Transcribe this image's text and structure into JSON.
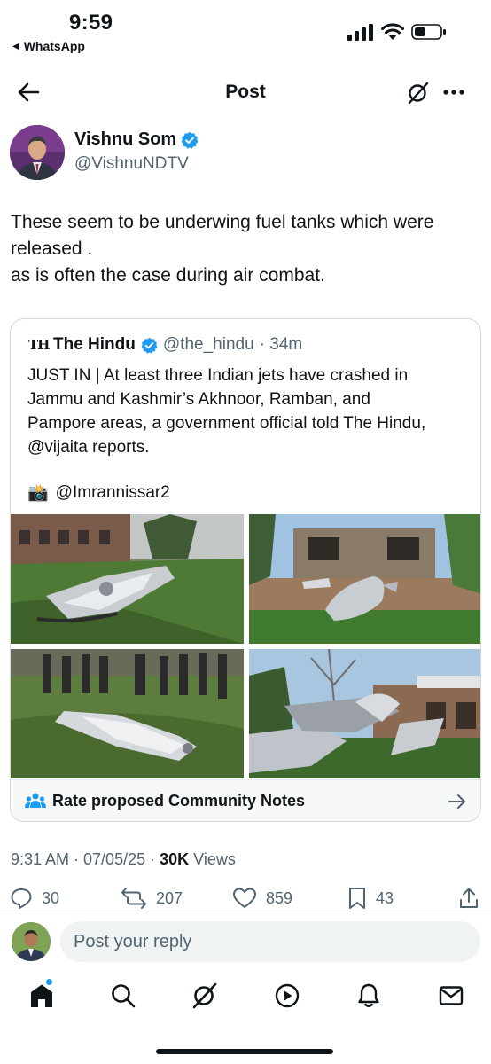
{
  "status_bar": {
    "time": "9:59",
    "back_app": "WhatsApp",
    "icons": [
      "cellular-signal-icon",
      "wifi-icon",
      "battery-icon"
    ]
  },
  "header": {
    "title": "Post",
    "icons": [
      "back-arrow-icon",
      "grok-icon",
      "more-icon"
    ]
  },
  "post": {
    "author_name": "Vishnu Som",
    "author_handle": "@VishnuNDTV",
    "verified": true,
    "text_lines": [
      "These seem to be underwing fuel tanks which were",
      "released .",
      "as is often the case during air combat."
    ],
    "timestamp": "9:31 AM · 07/05/25 · ",
    "views_count": "30K",
    "views_label": " Views"
  },
  "quote": {
    "source_logo": "TH",
    "name": "The Hindu",
    "handle": "@the_hindu",
    "age": "· 34m",
    "text_lines": [
      "JUST IN | At least three Indian jets have crashed in",
      "Jammu and Kashmir’s Akhnoor, Ramban, and",
      "Pampore areas, a government official told The Hindu,",
      "@vijaita reports."
    ],
    "photo_credit_emoji": "📸",
    "photo_credit": "@Imrannissar2",
    "photos": [
      "wreckage-photo-1",
      "wreckage-photo-2",
      "wreckage-photo-3",
      "wreckage-photo-4"
    ]
  },
  "community_notes": {
    "label": "Rate proposed Community Notes"
  },
  "actions": {
    "replies": "30",
    "reposts": "207",
    "likes": "859",
    "bookmarks": "43"
  },
  "reply_box": {
    "placeholder": "Post your reply"
  },
  "tabbar": {
    "items": [
      "home-icon",
      "search-icon",
      "grok-icon",
      "video-icon",
      "notifications-icon",
      "messages-icon"
    ]
  },
  "colors": {
    "text": "#0f1419",
    "secondary": "#536471",
    "verified": "#1d9bf0",
    "border": "#cfd9de",
    "input_bg": "#eff3f4"
  }
}
